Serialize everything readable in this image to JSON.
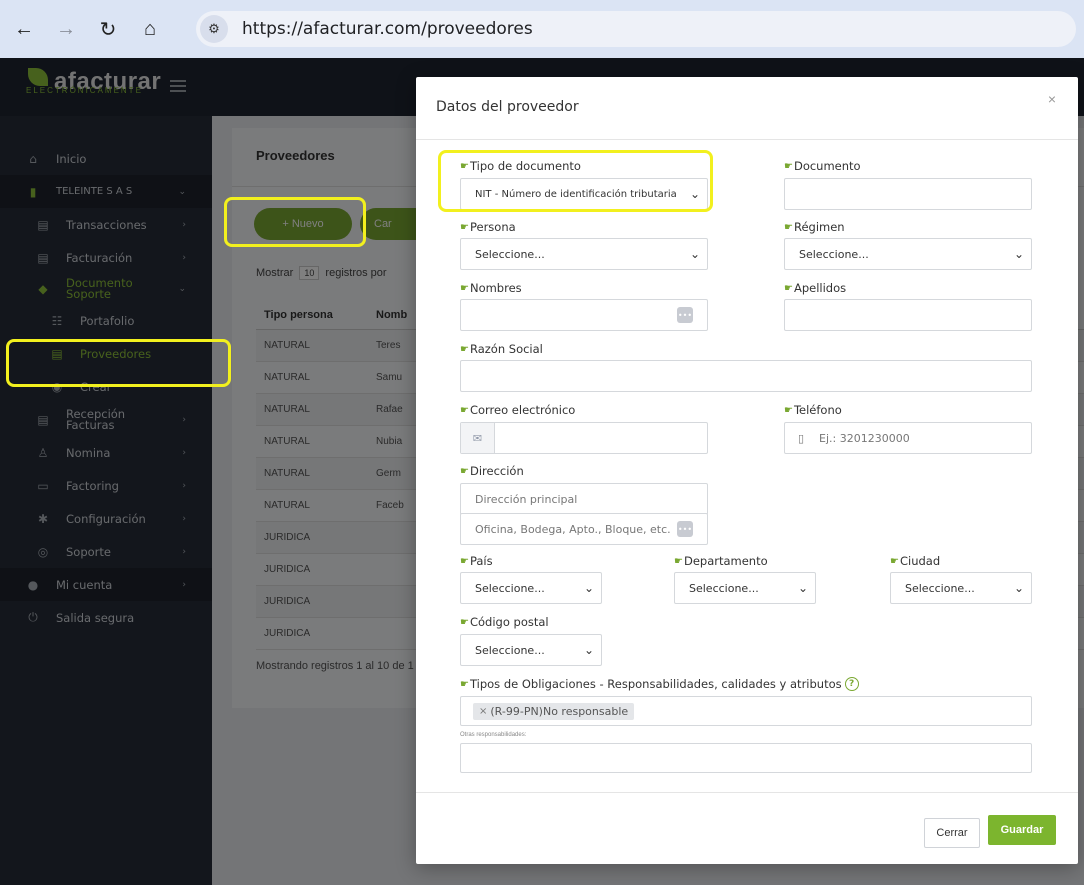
{
  "browser": {
    "url": "https://afacturar.com/proveedores"
  },
  "app": {
    "logo_text": "afacturar",
    "logo_sub": "ELECTRÓNICAMENTE"
  },
  "sidebar": {
    "items": [
      {
        "label": "Inicio"
      },
      {
        "label": "TELEINTE S A S"
      },
      {
        "label": "Transacciones"
      },
      {
        "label": "Facturación"
      },
      {
        "label": "Documento Soporte"
      },
      {
        "label": "Portafolio"
      },
      {
        "label": "Proveedores"
      },
      {
        "label": "Crear"
      },
      {
        "label": "Recepción Facturas"
      },
      {
        "label": "Nomina"
      },
      {
        "label": "Factoring"
      },
      {
        "label": "Configuración"
      },
      {
        "label": "Soporte"
      },
      {
        "label": "Mi cuenta"
      },
      {
        "label": "Salida segura"
      }
    ]
  },
  "page": {
    "title": "Proveedores",
    "btn_nuevo": "+ Nuevo",
    "btn_cargar": "Car",
    "mostrar_prefix": "Mostrar",
    "mostrar_value": "10",
    "mostrar_suffix": "registros por",
    "table": {
      "headers": [
        "Tipo persona",
        "Nomb"
      ],
      "rows": [
        [
          "NATURAL",
          "Teres"
        ],
        [
          "NATURAL",
          "Samu"
        ],
        [
          "NATURAL",
          "Rafae"
        ],
        [
          "NATURAL",
          "Nubia"
        ],
        [
          "NATURAL",
          "Germ"
        ],
        [
          "NATURAL",
          "Faceb"
        ],
        [
          "JURIDICA",
          ""
        ],
        [
          "JURIDICA",
          ""
        ],
        [
          "JURIDICA",
          ""
        ],
        [
          "JURIDICA",
          ""
        ]
      ]
    },
    "showing": "Mostrando registros 1 al 10 de 1"
  },
  "modal": {
    "title": "Datos del proveedor",
    "close": "×",
    "fields": {
      "tipo_documento": {
        "label": "Tipo de documento",
        "value": "NIT - Número de identificación tributaria"
      },
      "documento": {
        "label": "Documento",
        "value": ""
      },
      "persona": {
        "label": "Persona",
        "value": "Seleccione..."
      },
      "regimen": {
        "label": "Régimen",
        "value": "Seleccione..."
      },
      "nombres": {
        "label": "Nombres",
        "value": ""
      },
      "apellidos": {
        "label": "Apellidos",
        "value": ""
      },
      "razon_social": {
        "label": "Razón Social",
        "value": ""
      },
      "correo": {
        "label": "Correo electrónico",
        "value": ""
      },
      "telefono": {
        "label": "Teléfono",
        "placeholder": "Ej.: 3201230000"
      },
      "direccion": {
        "label": "Dirección",
        "placeholder1": "Dirección principal",
        "placeholder2": "Oficina, Bodega, Apto., Bloque, etc."
      },
      "pais": {
        "label": "País",
        "value": "Seleccione..."
      },
      "departamento": {
        "label": "Departamento",
        "value": "Seleccione..."
      },
      "ciudad": {
        "label": "Ciudad",
        "value": "Seleccione..."
      },
      "codigo_postal": {
        "label": "Código postal",
        "value": "Seleccione..."
      },
      "obligaciones": {
        "label": "Tipos de Obligaciones - Responsabilidades, calidades y atributos",
        "tag": "(R-99-PN)No responsable"
      },
      "otras": {
        "label": "Otras responsabilidades:"
      }
    },
    "btn_cerrar": "Cerrar",
    "btn_guardar": "Guardar"
  },
  "colors": {
    "accent": "#7cb52e",
    "highlight": "#f2f01e",
    "sidebar_bg": "#262c38"
  }
}
